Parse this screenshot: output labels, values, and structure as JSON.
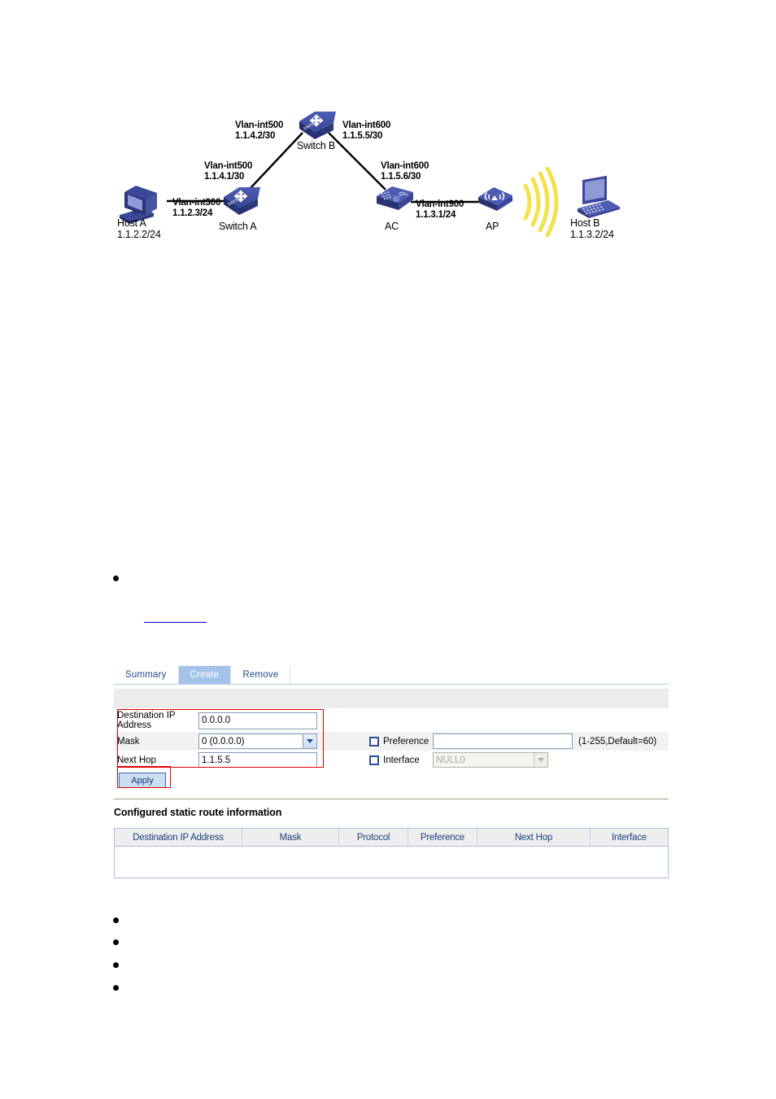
{
  "diagram": {
    "type": "network-topology",
    "nodes": [
      {
        "id": "host-a",
        "name": "Host A",
        "address": "1.1.2.2/24",
        "icon": "desktop-pc-icon"
      },
      {
        "id": "switch-a",
        "name": "Switch A",
        "address": "",
        "icon": "switch-icon"
      },
      {
        "id": "switch-b",
        "name": "Switch B",
        "address": "",
        "icon": "switch-icon"
      },
      {
        "id": "ac",
        "name": "AC",
        "address": "",
        "icon": "access-controller-icon"
      },
      {
        "id": "ap",
        "name": "AP",
        "address": "",
        "icon": "access-point-icon"
      },
      {
        "id": "host-b",
        "name": "Host B",
        "address": "1.1.3.2/24",
        "icon": "laptop-icon"
      }
    ],
    "link_labels": [
      {
        "id": "switchb-left",
        "interface": "Vlan-int500",
        "address": "1.1.4.2/30"
      },
      {
        "id": "switchb-right",
        "interface": "Vlan-int600",
        "address": "1.1.5.5/30"
      },
      {
        "id": "switcha-up",
        "interface": "Vlan-int500",
        "address": "1.1.4.1/30"
      },
      {
        "id": "ac-up",
        "interface": "Vlan-int600",
        "address": "1.1.5.6/30"
      },
      {
        "id": "switcha-host",
        "interface": "Vlan-int300",
        "address": "1.1.2.3/24"
      },
      {
        "id": "ac-ap",
        "interface": "Vlan-int900",
        "address": "1.1.3.1/24"
      }
    ]
  },
  "ui": {
    "tabs": [
      {
        "label": "Summary",
        "active": false
      },
      {
        "label": "Create",
        "active": true
      },
      {
        "label": "Remove",
        "active": false
      }
    ],
    "form": {
      "dest_label": "Destination IP Address",
      "dest_value": "0.0.0.0",
      "mask_label": "Mask",
      "mask_value": "0 (0.0.0.0)",
      "nexthop_label": "Next Hop",
      "nexthop_value": "1.1.5.5",
      "preference_label": "Preference",
      "preference_value": "",
      "preference_hint": "(1-255,Default=60)",
      "interface_label": "Interface",
      "interface_value": "NULL0",
      "apply_label": "Apply"
    },
    "section_title": "Configured static route information",
    "table": {
      "columns": [
        "Destination IP Address",
        "Mask",
        "Protocol",
        "Preference",
        "Next Hop",
        "Interface"
      ],
      "rows": []
    }
  },
  "colors": {
    "tab_active_bg": "#a3c3e8",
    "annotation_red": "#e00000",
    "device_blue": "#3a4a9a",
    "wifi_yellow": "#f2e34c",
    "link_blue": "#0000cc"
  }
}
